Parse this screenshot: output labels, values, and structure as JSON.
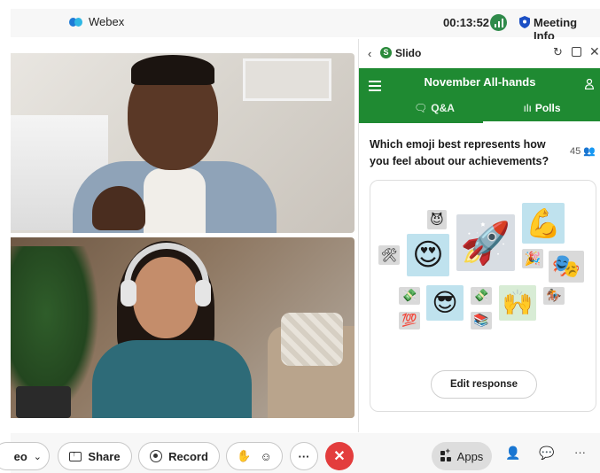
{
  "topbar": {
    "app_name": "Webex",
    "timer": "00:13:52",
    "meeting_info": "Meeting Info"
  },
  "slido": {
    "name": "Slido",
    "event_title": "November All-hands",
    "tabs": [
      {
        "label": "Q&A",
        "active": false
      },
      {
        "label": "Polls",
        "active": true
      }
    ],
    "question": "Which emoji best represents how you feel about our achievements?",
    "vote_count": "45",
    "edit_response": "Edit response"
  },
  "emoji_cloud": [
    {
      "emoji": "😈",
      "icon": "smiling-devil-emoji"
    },
    {
      "emoji": "😍",
      "icon": "heart-eyes-emoji"
    },
    {
      "emoji": "🚀",
      "icon": "rocket-emoji"
    },
    {
      "emoji": "💪",
      "icon": "flexed-biceps-emoji"
    },
    {
      "emoji": "🛠",
      "icon": "tools-emoji"
    },
    {
      "emoji": "🎉",
      "icon": "party-popper-emoji"
    },
    {
      "emoji": "🎭",
      "icon": "performing-arts-emoji"
    },
    {
      "emoji": "💸",
      "icon": "money-wings-emoji"
    },
    {
      "emoji": "😎",
      "icon": "sunglasses-emoji"
    },
    {
      "emoji": "💸",
      "icon": "money-wings-emoji-2"
    },
    {
      "emoji": "🙌",
      "icon": "raising-hands-emoji"
    },
    {
      "emoji": "🏇",
      "icon": "horse-racing-emoji"
    },
    {
      "emoji": "💯",
      "icon": "hundred-points-emoji"
    },
    {
      "emoji": "📚",
      "icon": "books-emoji"
    }
  ],
  "controls": {
    "video_label": "eo",
    "share": "Share",
    "record": "Record",
    "more": "···",
    "end": "✕",
    "apps": "Apps",
    "more2": "···"
  },
  "colors": {
    "slido_green": "#1f8a32",
    "end_red": "#e33d3d",
    "signal_green": "#2f8a4a"
  }
}
